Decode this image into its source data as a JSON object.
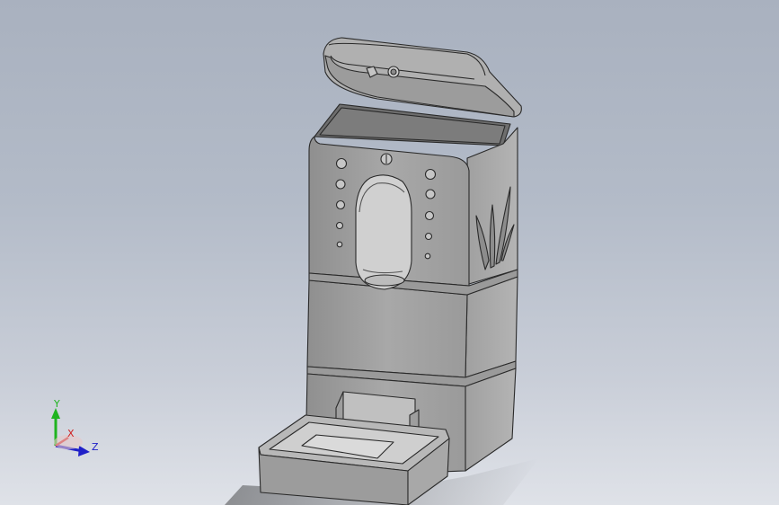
{
  "viewport": {
    "background_top": "#a9b1bf",
    "background_bottom": "#dfe2e8",
    "model_fill": "#a4a4a4",
    "model_edge": "#2a2a2a"
  },
  "triad": {
    "y_label": "Y",
    "x_label": "X",
    "z_label": "Z",
    "y_color": "#1fb41f",
    "x_color": "#d02020",
    "z_color": "#2020c8"
  }
}
